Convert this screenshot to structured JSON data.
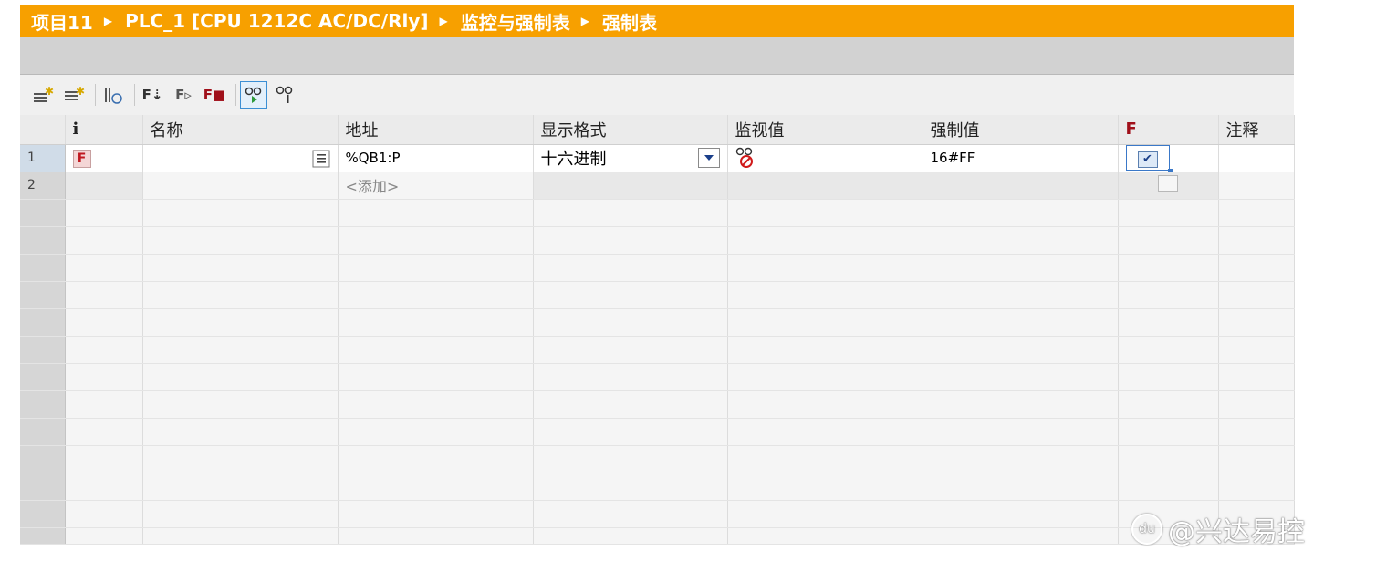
{
  "breadcrumb": [
    "项目11",
    "PLC_1 [CPU 1212C AC/DC/Rly]",
    "监控与强制表",
    "强制表"
  ],
  "toolbar": {
    "buttons": [
      "insert-row",
      "add-row",
      "update-values",
      "force-all",
      "force",
      "stop-force",
      "monitor-all",
      "monitor-once"
    ]
  },
  "table": {
    "headers": {
      "num": "",
      "info": "i",
      "name": "名称",
      "address": "地址",
      "format": "显示格式",
      "monitor": "监视值",
      "force": "强制值",
      "f": "F",
      "comment": "注释"
    },
    "rows": [
      {
        "num": "1",
        "info": "F",
        "name": "",
        "address": "%QB1:P",
        "format": "十六进制",
        "monitor": "",
        "force": "16#FF",
        "f_checked": true,
        "comment": ""
      },
      {
        "num": "2",
        "info": "",
        "name": "",
        "address": "<添加>",
        "format": "",
        "monitor": "",
        "force": "",
        "f_checked": false,
        "comment": ""
      }
    ]
  },
  "watermark": "@兴达易控",
  "colors": {
    "titlebar": "#f7a000",
    "f_header": "#a0101a"
  }
}
